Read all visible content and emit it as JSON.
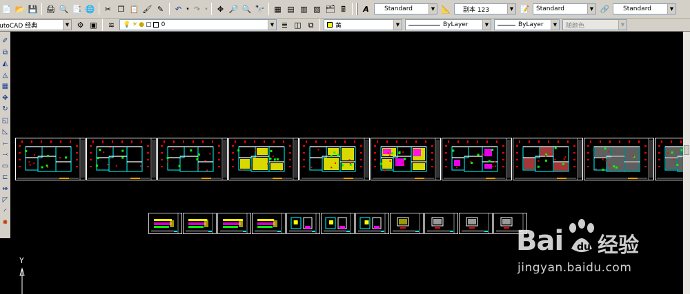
{
  "toolbar_top": {
    "text_style": {
      "value": "Standard"
    },
    "dim_style": {
      "value": "副本 123"
    },
    "table_style": {
      "value": "Standard"
    },
    "multileader_style": {
      "value": "Standard"
    }
  },
  "toolbar_props": {
    "workspace": {
      "value": "AutoCAD 经典"
    },
    "layer": {
      "value": "0"
    },
    "color": {
      "value": "黄",
      "hex": "#ffff00"
    },
    "linetype": {
      "value": "ByLayer"
    },
    "lineweight": {
      "value": "ByLayer"
    },
    "plotstyle": {
      "value": "随颜色"
    }
  },
  "ucs": {
    "y_label": "Y"
  },
  "watermark": {
    "brand": "Bai",
    "brand_cn": "经验",
    "url": "jingyan.baidu.com"
  },
  "colors": {
    "canvas": "#000000",
    "toolbar": "#d4d0c8",
    "wall": "#00ffff",
    "dims": "#ff0000",
    "fill_yellow": "#ffff00",
    "fill_magenta": "#ff00ff",
    "fill_green": "#00ff00"
  }
}
